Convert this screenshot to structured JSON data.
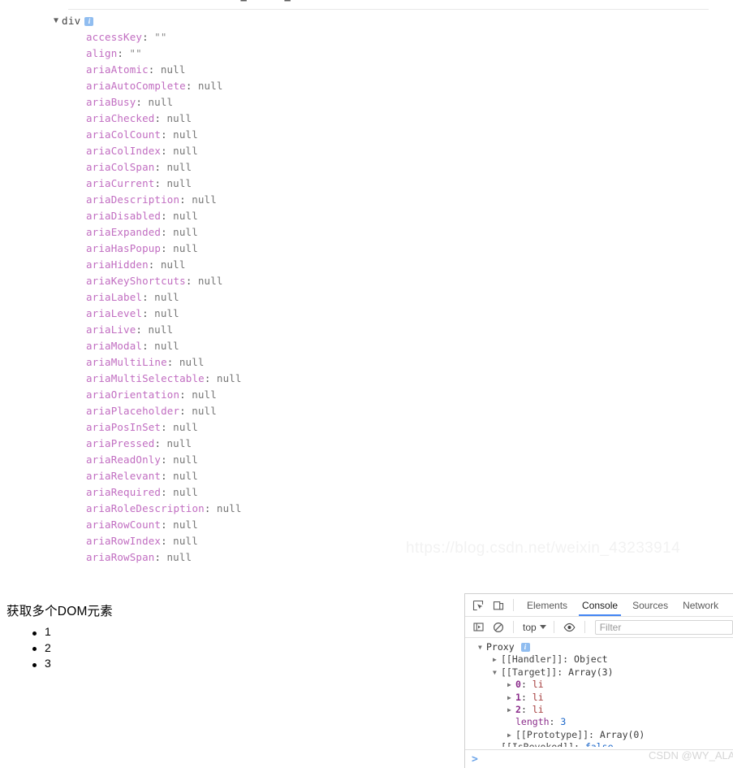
{
  "top_cutoff_line": "·  · ·  ▬·    ·  ·  ▬   ·",
  "inspector": {
    "root_label": "div",
    "root_badge_icon": "info-badge-icon",
    "disclosure_icon": "triangle-down-icon",
    "properties": [
      {
        "key": "accessKey",
        "value": "\"\"",
        "kind": "string"
      },
      {
        "key": "align",
        "value": "\"\"",
        "kind": "string"
      },
      {
        "key": "ariaAtomic",
        "value": "null",
        "kind": "null"
      },
      {
        "key": "ariaAutoComplete",
        "value": "null",
        "kind": "null"
      },
      {
        "key": "ariaBusy",
        "value": "null",
        "kind": "null"
      },
      {
        "key": "ariaChecked",
        "value": "null",
        "kind": "null"
      },
      {
        "key": "ariaColCount",
        "value": "null",
        "kind": "null"
      },
      {
        "key": "ariaColIndex",
        "value": "null",
        "kind": "null"
      },
      {
        "key": "ariaColSpan",
        "value": "null",
        "kind": "null"
      },
      {
        "key": "ariaCurrent",
        "value": "null",
        "kind": "null"
      },
      {
        "key": "ariaDescription",
        "value": "null",
        "kind": "null"
      },
      {
        "key": "ariaDisabled",
        "value": "null",
        "kind": "null"
      },
      {
        "key": "ariaExpanded",
        "value": "null",
        "kind": "null"
      },
      {
        "key": "ariaHasPopup",
        "value": "null",
        "kind": "null"
      },
      {
        "key": "ariaHidden",
        "value": "null",
        "kind": "null"
      },
      {
        "key": "ariaKeyShortcuts",
        "value": "null",
        "kind": "null"
      },
      {
        "key": "ariaLabel",
        "value": "null",
        "kind": "null"
      },
      {
        "key": "ariaLevel",
        "value": "null",
        "kind": "null"
      },
      {
        "key": "ariaLive",
        "value": "null",
        "kind": "null"
      },
      {
        "key": "ariaModal",
        "value": "null",
        "kind": "null"
      },
      {
        "key": "ariaMultiLine",
        "value": "null",
        "kind": "null"
      },
      {
        "key": "ariaMultiSelectable",
        "value": "null",
        "kind": "null"
      },
      {
        "key": "ariaOrientation",
        "value": "null",
        "kind": "null"
      },
      {
        "key": "ariaPlaceholder",
        "value": "null",
        "kind": "null"
      },
      {
        "key": "ariaPosInSet",
        "value": "null",
        "kind": "null"
      },
      {
        "key": "ariaPressed",
        "value": "null",
        "kind": "null"
      },
      {
        "key": "ariaReadOnly",
        "value": "null",
        "kind": "null"
      },
      {
        "key": "ariaRelevant",
        "value": "null",
        "kind": "null"
      },
      {
        "key": "ariaRequired",
        "value": "null",
        "kind": "null"
      },
      {
        "key": "ariaRoleDescription",
        "value": "null",
        "kind": "null"
      },
      {
        "key": "ariaRowCount",
        "value": "null",
        "kind": "null"
      },
      {
        "key": "ariaRowIndex",
        "value": "null",
        "kind": "null"
      },
      {
        "key": "ariaRowSpan",
        "value": "null",
        "kind": "null"
      }
    ]
  },
  "watermarks": {
    "url": "https://blog.csdn.net/weixin_43233914",
    "csdn": "CSDN @WY_ALA"
  },
  "page": {
    "heading": "获取多个DOM元素",
    "list_items": [
      "1",
      "2",
      "3"
    ]
  },
  "devtools": {
    "toolbar_icons": {
      "inspect": "inspect-element-icon",
      "device": "device-toolbar-icon"
    },
    "tabs": [
      {
        "label": "Elements",
        "active": false
      },
      {
        "label": "Console",
        "active": true
      },
      {
        "label": "Sources",
        "active": false
      },
      {
        "label": "Network",
        "active": false
      }
    ],
    "filterbar": {
      "sidebar_icon": "console-sidebar-icon",
      "clear_icon": "clear-console-icon",
      "context_label": "top",
      "context_caret": "chevron-down-icon",
      "eye_icon": "live-expression-eye-icon",
      "filter_placeholder": "Filter",
      "filter_value": ""
    },
    "console_output": [
      {
        "indent": 0,
        "tri": "open",
        "parts": [
          {
            "t": "Proxy ",
            "c": "c-name"
          }
        ],
        "badge": true
      },
      {
        "indent": 1,
        "tri": "closed",
        "parts": [
          {
            "t": "[[Handler]]",
            "c": "c-intern"
          },
          {
            "t": ": ",
            "c": "c-obj"
          },
          {
            "t": "Object",
            "c": "c-obj"
          }
        ]
      },
      {
        "indent": 1,
        "tri": "open",
        "parts": [
          {
            "t": "[[Target]]",
            "c": "c-intern"
          },
          {
            "t": ": ",
            "c": "c-obj"
          },
          {
            "t": "Array(3)",
            "c": "c-obj"
          }
        ]
      },
      {
        "indent": 2,
        "tri": "closed",
        "parts": [
          {
            "t": "0",
            "c": "c-idx"
          },
          {
            "t": ": ",
            "c": "c-obj"
          },
          {
            "t": "li",
            "c": "c-node"
          }
        ]
      },
      {
        "indent": 2,
        "tri": "closed",
        "parts": [
          {
            "t": "1",
            "c": "c-idx"
          },
          {
            "t": ": ",
            "c": "c-obj"
          },
          {
            "t": "li",
            "c": "c-node"
          }
        ]
      },
      {
        "indent": 2,
        "tri": "closed",
        "parts": [
          {
            "t": "2",
            "c": "c-idx"
          },
          {
            "t": ": ",
            "c": "c-obj"
          },
          {
            "t": "li",
            "c": "c-node"
          }
        ]
      },
      {
        "indent": 2,
        "tri": "none",
        "parts": [
          {
            "t": "length",
            "c": "c-key"
          },
          {
            "t": ": ",
            "c": "c-obj"
          },
          {
            "t": "3",
            "c": "c-num"
          }
        ]
      },
      {
        "indent": 2,
        "tri": "closed",
        "parts": [
          {
            "t": "[[Prototype]]",
            "c": "c-intern"
          },
          {
            "t": ": ",
            "c": "c-obj"
          },
          {
            "t": "Array(0)",
            "c": "c-obj"
          }
        ]
      },
      {
        "indent": 1,
        "tri": "none",
        "parts": [
          {
            "t": "[[IsRevoked]]",
            "c": "c-intern"
          },
          {
            "t": ": ",
            "c": "c-obj"
          },
          {
            "t": "false",
            "c": "c-bool"
          }
        ]
      }
    ],
    "prompt_symbol": ">",
    "prompt_value": ""
  },
  "colors": {
    "accent_blue": "#4285f4",
    "property_key": "#c16dc1",
    "property_value": "#767676",
    "console_key": "#8b2d8b",
    "console_node": "#a33a3a",
    "console_number": "#1a66c9",
    "badge_blue": "#90bdf0",
    "watermark_gray": "#f2f2f2"
  }
}
